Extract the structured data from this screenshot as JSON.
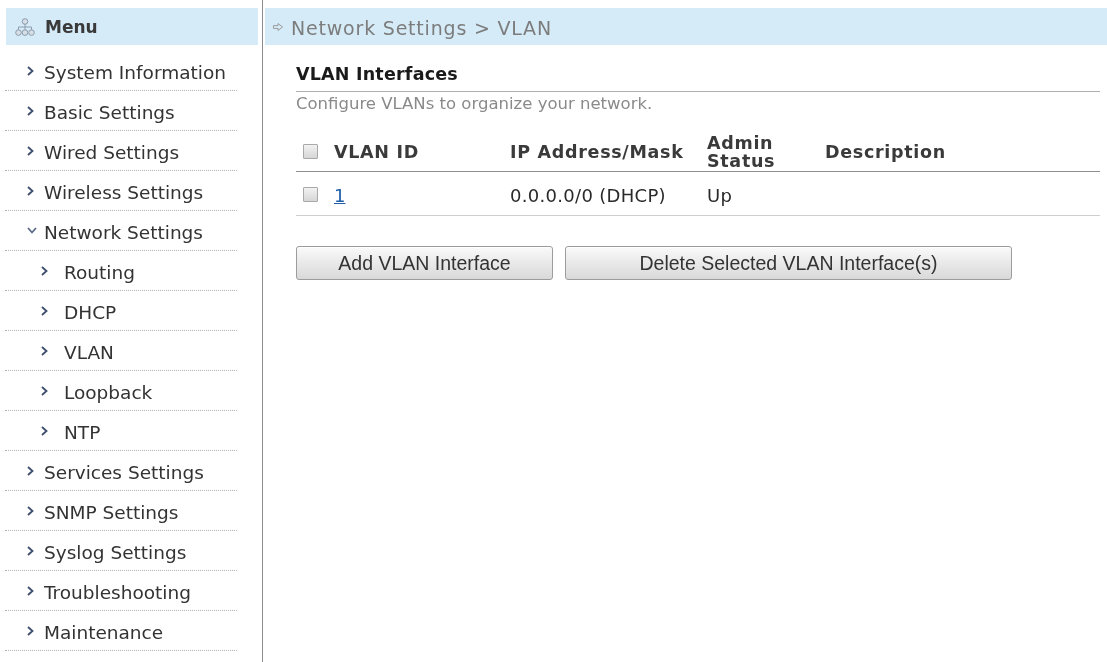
{
  "sidebar": {
    "title": "Menu",
    "items": [
      {
        "label": "System Information",
        "expanded": false
      },
      {
        "label": "Basic Settings",
        "expanded": false
      },
      {
        "label": "Wired Settings",
        "expanded": false
      },
      {
        "label": "Wireless Settings",
        "expanded": false
      },
      {
        "label": "Network Settings",
        "expanded": true,
        "children": [
          {
            "label": "Routing"
          },
          {
            "label": "DHCP"
          },
          {
            "label": "VLAN"
          },
          {
            "label": "Loopback"
          },
          {
            "label": "NTP"
          }
        ]
      },
      {
        "label": "Services Settings",
        "expanded": false
      },
      {
        "label": "SNMP Settings",
        "expanded": false
      },
      {
        "label": "Syslog Settings",
        "expanded": false
      },
      {
        "label": "Troubleshooting",
        "expanded": false
      },
      {
        "label": "Maintenance",
        "expanded": false
      }
    ]
  },
  "breadcrumb": "Network Settings > VLAN",
  "section": {
    "title": "VLAN Interfaces",
    "description": "Configure VLANs to organize your network."
  },
  "table": {
    "select_all": {
      "checked": false
    },
    "columns": [
      "VLAN ID",
      "IP Address/Mask",
      "Admin Status",
      "Description"
    ],
    "rows": [
      {
        "checked": false,
        "vlan_id": "1",
        "ip_address": "0.0.0.0/0 (DHCP)",
        "admin_status": "Up"
      }
    ]
  },
  "buttons": [
    "Add VLAN Interface",
    "Delete Selected VLAN Interface(s)"
  ]
}
